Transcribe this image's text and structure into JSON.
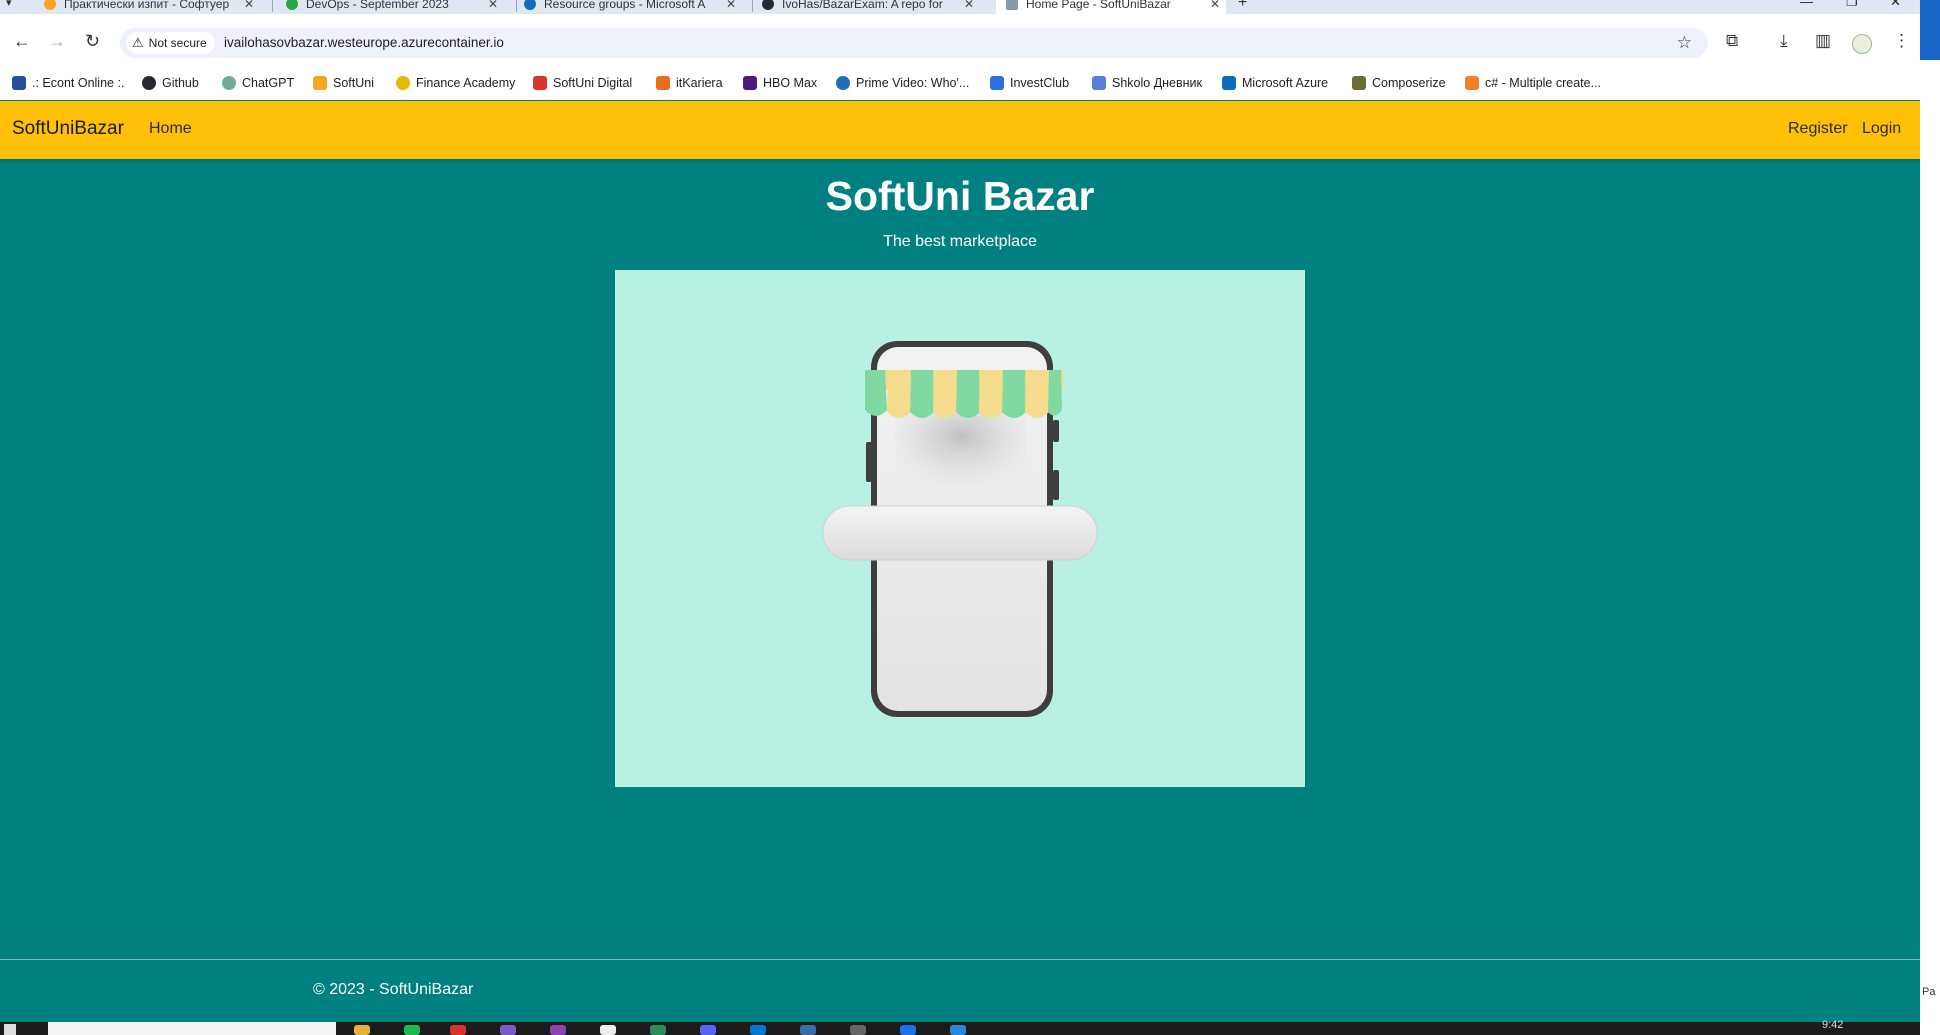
{
  "browser": {
    "tabs": [
      {
        "title": "Практически изпит - Софтуер",
        "icon_color": "#f5a623"
      },
      {
        "title": "DevOps - September 2023",
        "icon_color": "#28a745"
      },
      {
        "title": "Resource groups - Microsoft A",
        "icon_color": "#0f6cbd"
      },
      {
        "title": "IvoHas/BazarExam: A repo for",
        "icon_color": "#24292f"
      },
      {
        "title": "Home Page - SoftUniBazar",
        "icon_color": "#8899aa",
        "active": true
      }
    ],
    "security_label": "Not secure",
    "url": "ivailohasovbazar.westeurope.azurecontainer.io",
    "bookmarks": [
      {
        "label": ".: Econt Online :.",
        "icon_color": "#2a4d9b"
      },
      {
        "label": "Github",
        "icon_color": "#24292f"
      },
      {
        "label": "ChatGPT",
        "icon_color": "#74aa9c"
      },
      {
        "label": "SoftUni",
        "icon_color": "#f5a623"
      },
      {
        "label": "Finance Academy",
        "icon_color": "#e6b800"
      },
      {
        "label": "SoftUni Digital",
        "icon_color": "#d9342b"
      },
      {
        "label": "itKariera",
        "icon_color": "#e86b1f"
      },
      {
        "label": "HBO Max",
        "icon_color": "#4b1a7c"
      },
      {
        "label": "Prime Video: Who'...",
        "icon_color": "#1f6fb2"
      },
      {
        "label": "InvestClub",
        "icon_color": "#2b6fe0"
      },
      {
        "label": "Shkolo Дневник",
        "icon_color": "#5b7fd6"
      },
      {
        "label": "Microsoft Azure",
        "icon_color": "#0f6cbd"
      },
      {
        "label": "Composerize",
        "icon_color": "#6b6b3a"
      },
      {
        "label": "c# - Multiple create...",
        "icon_color": "#f48024"
      }
    ],
    "side_tag": "Pa"
  },
  "site": {
    "brand": "SoftUniBazar",
    "nav_left": [
      "Home"
    ],
    "nav_right": [
      "Register",
      "Login"
    ],
    "title": "SoftUni Bazar",
    "subtitle": "The best marketplace",
    "footer": "© 2023 - SoftUniBazar",
    "colors": {
      "navbar": "#ffc107",
      "background": "#008080",
      "hero": "#b9f0e4"
    }
  },
  "taskbar": {
    "clock": "9:42"
  }
}
